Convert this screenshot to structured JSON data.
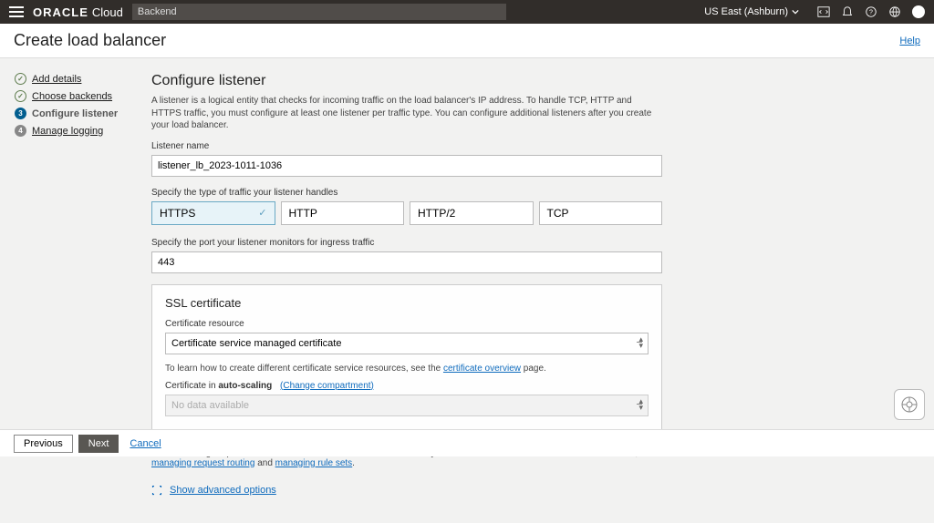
{
  "topbar": {
    "brand1": "ORACLE",
    "brand2": "Cloud",
    "search_value": "Backend",
    "region": "US East (Ashburn)"
  },
  "header": {
    "title": "Create load balancer",
    "help": "Help"
  },
  "steps": [
    {
      "label": "Add details",
      "state": "done"
    },
    {
      "label": "Choose backends",
      "state": "done"
    },
    {
      "label": "Configure listener",
      "state": "current"
    },
    {
      "label": "Manage logging",
      "state": "future",
      "num": "4"
    }
  ],
  "main": {
    "heading": "Configure listener",
    "desc": "A listener is a logical entity that checks for incoming traffic on the load balancer's IP address. To handle TCP, HTTP and HTTPS traffic, you must configure at least one listener per traffic type. You can configure additional listeners after you create your load balancer.",
    "listener_name_label": "Listener name",
    "listener_name_value": "listener_lb_2023-1011-1036",
    "traffic_label": "Specify the type of traffic your listener handles",
    "traffic_options": [
      "HTTPS",
      "HTTP",
      "HTTP/2",
      "TCP"
    ],
    "port_label": "Specify the port your listener monitors for ingress traffic",
    "port_value": "443",
    "ssl": {
      "title": "SSL certificate",
      "resource_label": "Certificate resource",
      "resource_value": "Certificate service managed certificate",
      "learn_prefix": "To learn how to create different certificate service resources, see the ",
      "learn_link": "certificate overview",
      "learn_suffix": " page.",
      "comp_prefix": "Certificate in ",
      "comp_bold": "auto-scaling",
      "comp_change": "(Change compartment)",
      "comp_value": "No data available"
    },
    "info_prefix": "You can configure path route rules and custom header rule sets after you create the load balancer. For more information, see ",
    "info_link1": "managing request routing",
    "info_and": " and ",
    "info_link2": "managing rule sets",
    "info_suffix": ".",
    "advanced": "Show advanced options"
  },
  "footer": {
    "previous": "Previous",
    "next": "Next",
    "cancel": "Cancel"
  }
}
